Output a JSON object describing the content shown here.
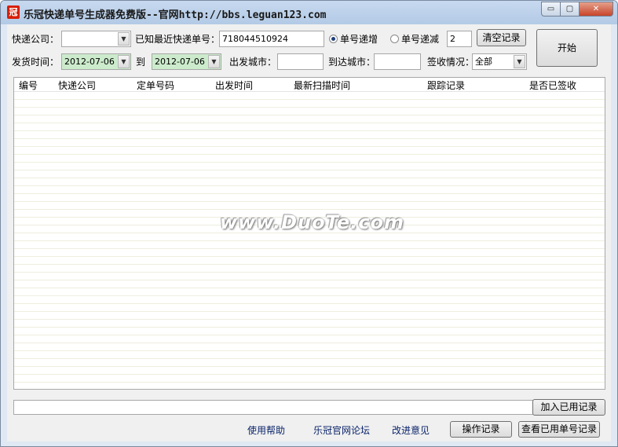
{
  "window": {
    "title": "乐冠快递单号生成器免费版--官网http://bbs.leguan123.com",
    "icon_glyph": "冠",
    "min_glyph": "▭",
    "max_glyph": "▢",
    "close_glyph": "✕"
  },
  "form": {
    "company_label": "快递公司：",
    "company_value": "",
    "last_number_label": "已知最近快递单号：",
    "last_number_value": "718044510924",
    "radio_increase_label": "单号递增",
    "radio_decrease_label": "单号递减",
    "radio_selected": "increase",
    "step_value": "2",
    "clear_button": "清空记录",
    "start_button": "开始",
    "ship_time_label": "发货时间：",
    "date_from": "2012-07-06",
    "to_label": "到",
    "date_to": "2012-07-06",
    "origin_city_label": "出发城市：",
    "origin_city_value": "",
    "dest_city_label": "到达城市：",
    "dest_city_value": "",
    "signed_label": "签收情况：",
    "signed_value": "全部"
  },
  "grid": {
    "columns": [
      "编号",
      "快递公司",
      "定单号码",
      "出发时间",
      "最新扫描时间",
      "跟踪记录",
      "是否已签收"
    ],
    "rows": []
  },
  "watermark": "www.DuoTe.com",
  "status_value": "",
  "footer": {
    "add_record_button": "加入已用记录",
    "help_link": "使用帮助",
    "forum_link": "乐冠官网论坛",
    "feedback_link": "改进意见",
    "operation_log_button": "操作记录",
    "view_used_button": "查看已用单号记录"
  }
}
